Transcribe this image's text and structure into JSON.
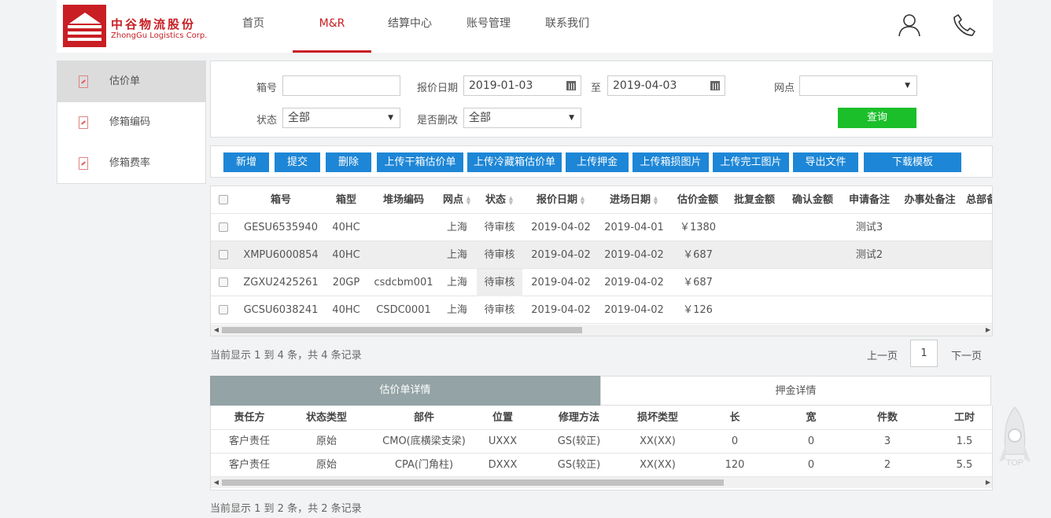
{
  "header": {
    "logo_cn": "中谷物流股份",
    "logo_en": "ZhongGu Logistics Corp.",
    "nav": [
      {
        "label": "首页",
        "active": false
      },
      {
        "label": "M&R",
        "active": true
      },
      {
        "label": "结算中心",
        "active": false
      },
      {
        "label": "账号管理",
        "active": false
      },
      {
        "label": "联系我们",
        "active": false
      }
    ],
    "icons": [
      "user-icon",
      "phone-icon"
    ],
    "accent_color": "#c81e24"
  },
  "sidebar": {
    "items": [
      {
        "label": "估价单",
        "active": true,
        "icon": "document-icon"
      },
      {
        "label": "修箱编码",
        "active": false,
        "icon": "document-icon"
      },
      {
        "label": "修箱费率",
        "active": false,
        "icon": "document-icon"
      }
    ]
  },
  "filters": {
    "box_no_label": "箱号",
    "box_no_value": "",
    "quote_date_label": "报价日期",
    "date_from": "2019-01-03",
    "to_label": "至",
    "date_to": "2019-04-03",
    "outlet_label": "网点",
    "outlet_value": "",
    "status_label": "状态",
    "status_value": "全部",
    "modified_label": "是否删改",
    "modified_value": "全部",
    "query_label": "查询"
  },
  "toolbar": {
    "buttons": [
      "新增",
      "提交",
      "删除",
      "上传干箱估价单",
      "上传冷藏箱估价单",
      "上传押金",
      "上传箱损图片",
      "上传完工图片",
      "导出文件",
      "下载模板"
    ],
    "button_color": "#1d86d6"
  },
  "main_table": {
    "headers": [
      "箱号",
      "箱型",
      "堆场编码",
      "网点",
      "状态",
      "报价日期",
      "进场日期",
      "估价金额",
      "批复金额",
      "确认金额",
      "申请备注",
      "办事处备注",
      "总部备"
    ],
    "rows": [
      [
        "GESU6535940",
        "40HC",
        "",
        "上海",
        "待审核",
        "2019-04-02",
        "2019-04-01",
        "￥1380",
        "",
        "",
        "测试3",
        "",
        ""
      ],
      [
        "XMPU6000854",
        "40HC",
        "",
        "上海",
        "待审核",
        "2019-04-02",
        "2019-04-02",
        "￥687",
        "",
        "",
        "测试2",
        "",
        ""
      ],
      [
        "ZGXU2425261",
        "20GP",
        "csdcbm001",
        "上海",
        "待审核",
        "2019-04-02",
        "2019-04-02",
        "￥687",
        "",
        "",
        "",
        "",
        ""
      ],
      [
        "GCSU6038241",
        "40HC",
        "CSDC0001",
        "上海",
        "待审核",
        "2019-04-02",
        "2019-04-02",
        "￥126",
        "",
        "",
        "",
        "",
        ""
      ]
    ],
    "info": "当前显示 1 到 4 条，共 4 条记录",
    "prev_label": "上一页",
    "page": "1",
    "next_label": "下一页"
  },
  "detail": {
    "tabs": [
      {
        "label": "估价单详情",
        "active": true
      },
      {
        "label": "押金详情",
        "active": false
      }
    ],
    "headers": [
      "责任方",
      "状态类型",
      "部件",
      "位置",
      "修理方法",
      "损坏类型",
      "长",
      "宽",
      "件数",
      "工时"
    ],
    "rows": [
      [
        "客户责任",
        "原始",
        "CMO(底横梁支梁)",
        "UXXX",
        "GS(较正)",
        "XX(XX)",
        "0",
        "0",
        "3",
        "1.5"
      ],
      [
        "客户责任",
        "原始",
        "CPA(门角柱)",
        "DXXX",
        "GS(较正)",
        "XX(XX)",
        "120",
        "0",
        "2",
        "5.5"
      ]
    ],
    "info": "当前显示 1 到 2 条，共 2 条记录"
  },
  "back_to_top": {
    "label": "TOP",
    "icon": "rocket-icon"
  }
}
